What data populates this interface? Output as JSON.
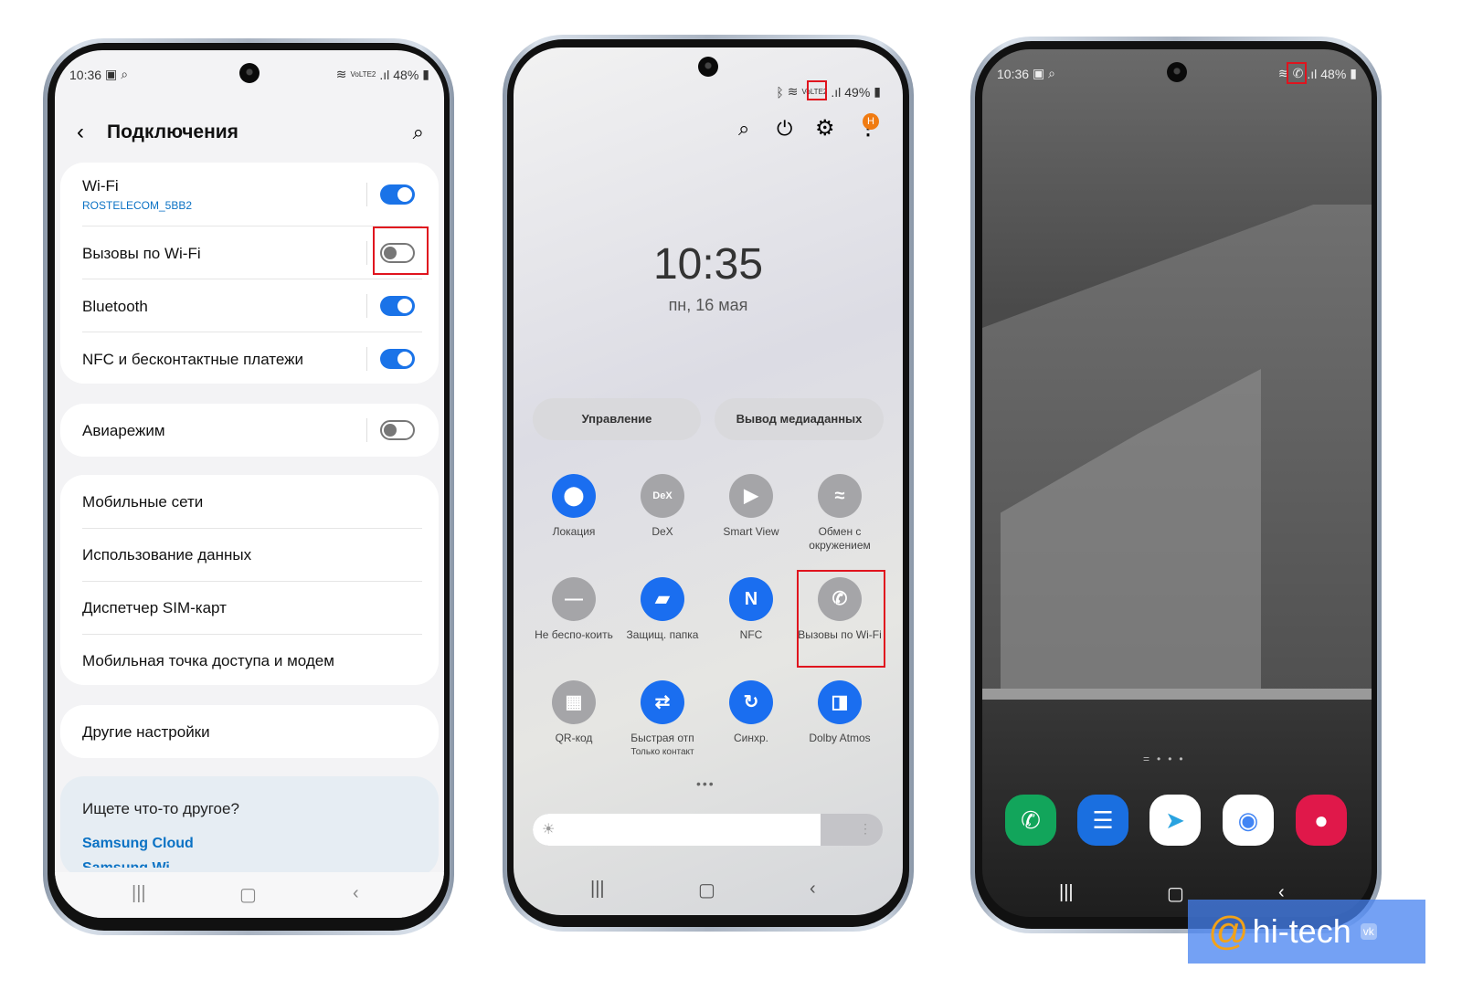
{
  "phone1": {
    "status": {
      "time": "10:36",
      "network": "VoLTE2",
      "battery": "48%"
    },
    "title": "Подключения",
    "wifi": {
      "label": "Wi-Fi",
      "network": "ROSTELECOM_5BB2",
      "on": true
    },
    "wifi_calls": {
      "label": "Вызовы по Wi-Fi",
      "on": false
    },
    "bluetooth": {
      "label": "Bluetooth",
      "on": true
    },
    "nfc": {
      "label": "NFC и бесконтактные платежи",
      "on": true
    },
    "airplane": {
      "label": "Авиарежим",
      "on": false
    },
    "items": [
      "Мобильные сети",
      "Использование данных",
      "Диспетчер SIM-карт",
      "Мобильная точка доступа и модем"
    ],
    "other": "Другие настройки",
    "suggest": {
      "title": "Ищете что-то другое?",
      "link1": "Samsung Cloud",
      "link2": "Samsung Wi..."
    }
  },
  "phone2": {
    "status": {
      "network": "VoLTE2",
      "battery": "49%"
    },
    "badge": "H",
    "clock": "10:35",
    "date": "пн, 16 мая",
    "buttons": [
      "Управление",
      "Вывод медиаданных"
    ],
    "tiles": [
      {
        "label": "Локация",
        "icon": "location-icon",
        "active": true,
        "glyph": "⬤"
      },
      {
        "label": "DeX",
        "icon": "dex-icon",
        "active": false,
        "glyph": "DeX"
      },
      {
        "label": "Smart View",
        "icon": "smart-view-icon",
        "active": false,
        "glyph": "▶"
      },
      {
        "label": "Обмен с окружением",
        "icon": "nearby-share-icon",
        "active": false,
        "glyph": "≈"
      },
      {
        "label": "Не беспо-коить",
        "icon": "do-not-disturb-icon",
        "active": false,
        "glyph": "—"
      },
      {
        "label": "Защищ. папка",
        "icon": "secure-folder-icon",
        "active": true,
        "glyph": "▰"
      },
      {
        "label": "NFC",
        "icon": "nfc-icon",
        "active": true,
        "glyph": "N"
      },
      {
        "label": "Вызовы по Wi-Fi",
        "icon": "wifi-call-icon",
        "active": false,
        "glyph": "✆"
      },
      {
        "label": "QR-код",
        "icon": "qr-code-icon",
        "active": false,
        "glyph": "▦"
      },
      {
        "label": "Быстрая отп",
        "sub": "Только контакт",
        "icon": "quick-share-icon",
        "active": true,
        "glyph": "⇄"
      },
      {
        "label": "Синхр.",
        "icon": "sync-icon",
        "active": true,
        "glyph": "↻"
      },
      {
        "label": "Dolby Atmos",
        "icon": "dolby-icon",
        "active": true,
        "glyph": "◨"
      }
    ]
  },
  "phone3": {
    "status": {
      "time": "10:36",
      "battery": "48%"
    },
    "dock": [
      {
        "icon": "phone-app-icon",
        "color": "#12a55b"
      },
      {
        "icon": "messages-app-icon",
        "color": "#1a6fe0"
      },
      {
        "icon": "telegram-app-icon",
        "color": "#ffffff"
      },
      {
        "icon": "chrome-app-icon",
        "color": "#ffffff"
      },
      {
        "icon": "camera-app-icon",
        "color": "#e0184a"
      }
    ]
  },
  "watermark": "hi-tech",
  "colors": {
    "accent": "#1a73e8",
    "highlight": "#e0141e",
    "link": "#0b72c4"
  }
}
